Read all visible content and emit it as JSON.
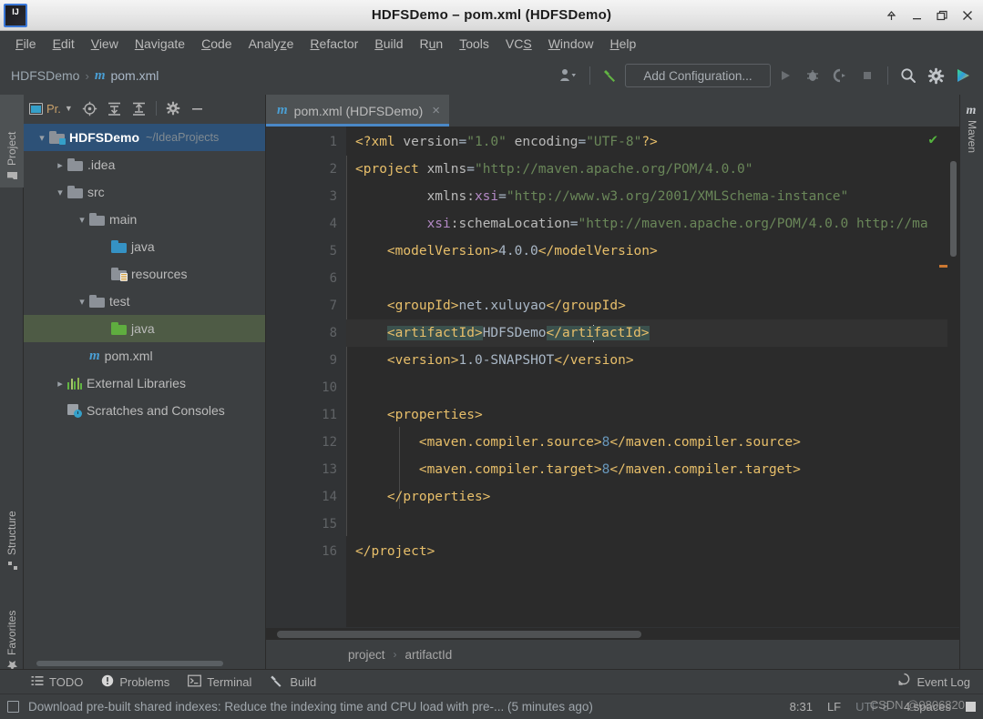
{
  "window": {
    "title": "HDFSDemo – pom.xml (HDFSDemo)",
    "logo_text": "IJ",
    "controls": {
      "maximize_up": "collapse-icon",
      "minimize": "minimize-icon",
      "restore": "restore-icon",
      "close": "close-icon"
    }
  },
  "menubar": {
    "items": [
      {
        "label": "File",
        "mnemonic": "F"
      },
      {
        "label": "Edit",
        "mnemonic": "E"
      },
      {
        "label": "View",
        "mnemonic": "V"
      },
      {
        "label": "Navigate",
        "mnemonic": "N"
      },
      {
        "label": "Code",
        "mnemonic": "C"
      },
      {
        "label": "Analyze",
        "mnemonic": "z"
      },
      {
        "label": "Refactor",
        "mnemonic": "R"
      },
      {
        "label": "Build",
        "mnemonic": "B"
      },
      {
        "label": "Run",
        "mnemonic": "u"
      },
      {
        "label": "Tools",
        "mnemonic": "T"
      },
      {
        "label": "VCS",
        "mnemonic": "S"
      },
      {
        "label": "Window",
        "mnemonic": "W"
      },
      {
        "label": "Help",
        "mnemonic": "H"
      }
    ]
  },
  "toolbar": {
    "breadcrumb_project": "HDFSDemo",
    "breadcrumb_sep": "›",
    "breadcrumb_file": "pom.xml",
    "file_icon": "m",
    "add_configuration": "Add Configuration...",
    "icons": {
      "user": "user-dropdown-icon",
      "hammer": "build-hammer-icon",
      "run": "run-icon",
      "debug": "debug-icon",
      "coverage": "run-with-coverage-icon",
      "stop": "stop-icon",
      "search": "search-everywhere-icon",
      "settings": "settings-gear-icon",
      "trainer": "ide-features-trainer-icon"
    }
  },
  "left_strip": {
    "tabs": [
      {
        "label": "Project",
        "icon": "project-folder-icon",
        "active": true
      },
      {
        "label": "Structure",
        "icon": "structure-icon",
        "active": false
      },
      {
        "label": "Favorites",
        "icon": "favorites-star-icon",
        "active": false
      }
    ]
  },
  "right_strip": {
    "tabs": [
      {
        "label": "Maven",
        "icon": "maven-m-icon",
        "active": false
      }
    ]
  },
  "project_panel": {
    "title": "Pr.",
    "header_icons": [
      "select-opened-file-icon",
      "expand-all-icon",
      "collapse-all-icon",
      "settings-gear-icon",
      "hide-icon"
    ],
    "tree": [
      {
        "label": "HDFSDemo",
        "path": "~/IdeaProjects",
        "chevron": "down",
        "indent": 0,
        "icon": "project-root-folder",
        "state": "selected-blue"
      },
      {
        "label": ".idea",
        "path": "",
        "chevron": "right",
        "indent": 1,
        "icon": "folder-gray",
        "state": "none"
      },
      {
        "label": "src",
        "path": "",
        "chevron": "down",
        "indent": 1,
        "icon": "folder-gray",
        "state": "none"
      },
      {
        "label": "main",
        "path": "",
        "chevron": "down",
        "indent": 2,
        "icon": "folder-gray",
        "state": "none"
      },
      {
        "label": "java",
        "path": "",
        "chevron": "none",
        "indent": 3,
        "icon": "folder-blue-sources",
        "state": "none"
      },
      {
        "label": "resources",
        "path": "",
        "chevron": "none",
        "indent": 3,
        "icon": "folder-resources",
        "state": "none"
      },
      {
        "label": "test",
        "path": "",
        "chevron": "down",
        "indent": 2,
        "icon": "folder-gray",
        "state": "none"
      },
      {
        "label": "java",
        "path": "",
        "chevron": "none",
        "indent": 3,
        "icon": "folder-green-test",
        "state": "selected-green"
      },
      {
        "label": "pom.xml",
        "path": "",
        "chevron": "none",
        "indent": 2,
        "icon": "maven-m-icon",
        "state": "none"
      },
      {
        "label": "External Libraries",
        "path": "",
        "chevron": "right",
        "indent": 1,
        "icon": "libraries-icon",
        "state": "none"
      },
      {
        "label": "Scratches and Consoles",
        "path": "",
        "chevron": "none",
        "indent": 1,
        "icon": "scratches-icon",
        "state": "none"
      }
    ]
  },
  "editor": {
    "tab": {
      "label": "pom.xml (HDFSDemo)",
      "icon": "maven-m-icon",
      "close": "×"
    },
    "line_numbers": [
      "1",
      "2",
      "3",
      "4",
      "5",
      "6",
      "7",
      "8",
      "9",
      "10",
      "11",
      "12",
      "13",
      "14",
      "15",
      "16"
    ],
    "inspection_status": "✔",
    "breadcrumbs": [
      "project",
      "artifactId"
    ],
    "breadcrumb_sep": "›",
    "code_lines": [
      {
        "n": 1,
        "tokens": [
          {
            "t": "<?xml ",
            "c": "punc"
          },
          {
            "t": "version",
            "c": "attr"
          },
          {
            "t": "=",
            "c": "txt"
          },
          {
            "t": "\"1.0\"",
            "c": "str"
          },
          {
            "t": " ",
            "c": "txt"
          },
          {
            "t": "encoding",
            "c": "attr"
          },
          {
            "t": "=",
            "c": "txt"
          },
          {
            "t": "\"UTF-8\"",
            "c": "str"
          },
          {
            "t": "?>",
            "c": "punc"
          }
        ]
      },
      {
        "n": 2,
        "tokens": [
          {
            "t": "<project ",
            "c": "tag"
          },
          {
            "t": "xmlns",
            "c": "attr"
          },
          {
            "t": "=",
            "c": "txt"
          },
          {
            "t": "\"http://maven.apache.org/POM/4.0.0\"",
            "c": "str"
          }
        ]
      },
      {
        "n": 3,
        "tokens": [
          {
            "t": "         xmlns:",
            "c": "attr"
          },
          {
            "t": "xsi",
            "c": "attrns"
          },
          {
            "t": "=",
            "c": "txt"
          },
          {
            "t": "\"http://www.w3.org/2001/XMLSchema-instance\"",
            "c": "str"
          }
        ]
      },
      {
        "n": 4,
        "tokens": [
          {
            "t": "         ",
            "c": "txt"
          },
          {
            "t": "xsi",
            "c": "attrns"
          },
          {
            "t": ":schemaLocation",
            "c": "attr"
          },
          {
            "t": "=",
            "c": "txt"
          },
          {
            "t": "\"http://maven.apache.org/POM/4.0.0 http://ma",
            "c": "str"
          }
        ]
      },
      {
        "n": 5,
        "tokens": [
          {
            "t": "    <modelVersion>",
            "c": "tag"
          },
          {
            "t": "4.0.0",
            "c": "txt"
          },
          {
            "t": "</modelVersion>",
            "c": "tag"
          }
        ]
      },
      {
        "n": 6,
        "tokens": []
      },
      {
        "n": 7,
        "tokens": [
          {
            "t": "    <groupId>",
            "c": "tag"
          },
          {
            "t": "net.xuluyao",
            "c": "txt"
          },
          {
            "t": "</groupId>",
            "c": "tag"
          }
        ]
      },
      {
        "n": 8,
        "tokens": [
          {
            "t": "    ",
            "c": "txt"
          },
          {
            "t": "<artifactId>",
            "c": "tag-hl"
          },
          {
            "t": "HDFSDemo",
            "c": "txt"
          },
          {
            "t": "</arti",
            "c": "tag-hl"
          },
          {
            "t": "CARET",
            "c": "caret"
          },
          {
            "t": "factId>",
            "c": "tag-hl"
          }
        ]
      },
      {
        "n": 9,
        "tokens": [
          {
            "t": "    <version>",
            "c": "tag"
          },
          {
            "t": "1.0-SNAPSHOT",
            "c": "txt"
          },
          {
            "t": "</version>",
            "c": "tag"
          }
        ]
      },
      {
        "n": 10,
        "tokens": []
      },
      {
        "n": 11,
        "tokens": [
          {
            "t": "    <properties>",
            "c": "tag"
          }
        ]
      },
      {
        "n": 12,
        "tokens": [
          {
            "t": "        <maven.compiler.source>",
            "c": "tag"
          },
          {
            "t": "8",
            "c": "num"
          },
          {
            "t": "</maven.compiler.source>",
            "c": "tag"
          }
        ]
      },
      {
        "n": 13,
        "tokens": [
          {
            "t": "        <maven.compiler.target>",
            "c": "tag"
          },
          {
            "t": "8",
            "c": "num"
          },
          {
            "t": "</maven.compiler.target>",
            "c": "tag"
          }
        ]
      },
      {
        "n": 14,
        "tokens": [
          {
            "t": "    </properties>",
            "c": "tag"
          }
        ]
      },
      {
        "n": 15,
        "tokens": []
      },
      {
        "n": 16,
        "tokens": [
          {
            "t": "</project>",
            "c": "tag"
          }
        ]
      }
    ]
  },
  "bottom_strip": {
    "items": [
      {
        "label": "TODO",
        "icon": "todo-list-icon"
      },
      {
        "label": "Problems",
        "icon": "problems-warning-icon"
      },
      {
        "label": "Terminal",
        "icon": "terminal-icon"
      },
      {
        "label": "Build",
        "icon": "build-hammer-icon"
      }
    ],
    "event_log": {
      "label": "Event Log",
      "icon": "event-log-icon"
    }
  },
  "statusbar": {
    "message": "Download pre-built shared indexes: Reduce the indexing time and CPU load with pre-... (5 minutes ago)",
    "caret_position": "8:31",
    "line_separator": "LF",
    "encoding": "UTF-8",
    "indent": "4 spaces",
    "lock_icon": "unlocked-icon"
  },
  "watermark": "CSDN @0806820",
  "colors": {
    "editor_bg": "#2b2b2b",
    "panel_bg": "#3c3f41",
    "gutter_bg": "#313335",
    "selection_blue": "#2d5177",
    "selection_green": "#4e5b45",
    "tab_underline": "#4a88c7",
    "tag": "#e8bf6a",
    "string": "#6a8759",
    "number": "#6897bb",
    "text": "#a9b7c6",
    "checkmark": "#54b33e"
  }
}
